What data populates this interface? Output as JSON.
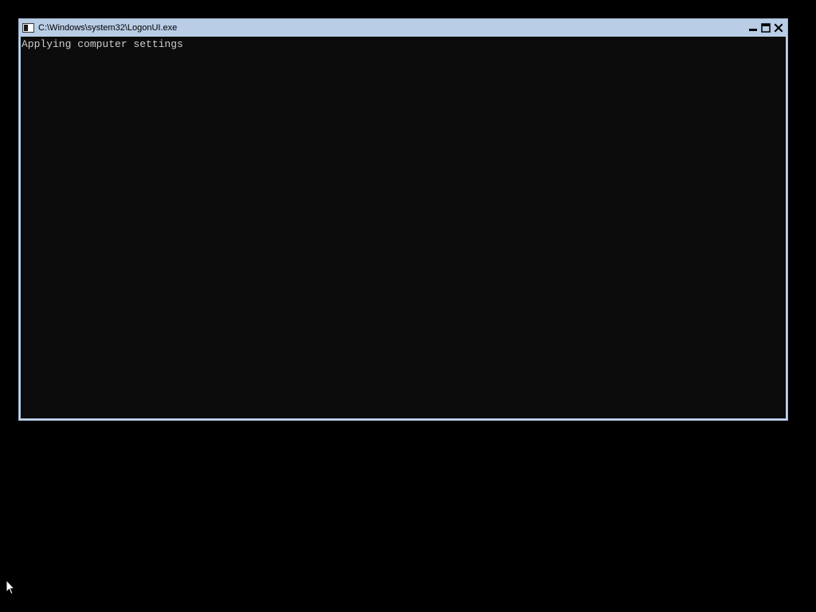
{
  "window": {
    "title": "C:\\Windows\\system32\\LogonUI.exe",
    "app_icon": "console-app-icon",
    "caption_buttons": {
      "minimize_icon": "minimize-icon",
      "maximize_icon": "maximize-icon",
      "close_icon": "close-icon"
    }
  },
  "console": {
    "lines": [
      "Applying computer settings"
    ]
  },
  "cursor": {
    "icon": "arrow-cursor-icon"
  },
  "colors": {
    "desktop_background": "#000000",
    "title_bar": "#b9cde6",
    "window_frame": "#b4c8e3",
    "console_background": "#0c0c0c",
    "console_text": "#cccccc"
  }
}
